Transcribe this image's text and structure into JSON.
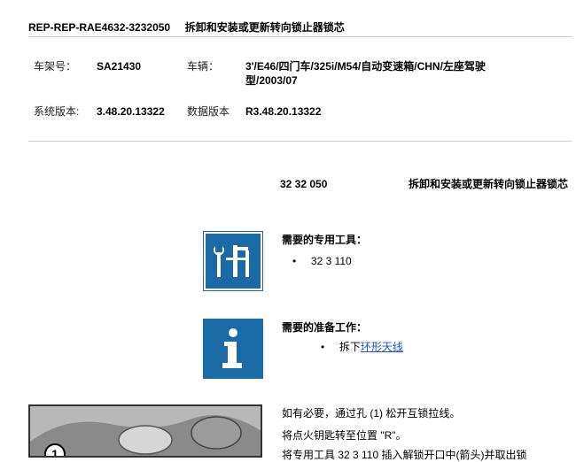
{
  "header": {
    "doc_id": "REP-REP-RAE4632-3232050",
    "doc_title": "拆卸和安装或更新转向锁止器锁芯"
  },
  "info": {
    "chassis_label": "车架号：",
    "chassis_value": "SA21430",
    "vehicle_label": "车辆：",
    "vehicle_value": "3'/E46/四门车/325i/M54/自动变速箱/CHN/左座驾驶型/2003/07",
    "sys_version_label": "系统版本:",
    "sys_version_value": "3.48.20.13322",
    "data_version_label": "数据版本",
    "data_version_value": "R3.48.20.13322"
  },
  "procedure": {
    "code": "32 32 050",
    "name": "拆卸和安装或更新转向锁止器锁芯"
  },
  "tools": {
    "icon": "tools-icon",
    "heading": "需要的专用工具：",
    "items": [
      "32 3 110"
    ]
  },
  "prep": {
    "icon": "info-icon",
    "heading": "需要的准备工作：",
    "item_prefix": "拆下",
    "item_link": "环形天线"
  },
  "steps": {
    "line1": "如有必要，通过孔 (1) 松开互锁拉线。",
    "line2": "将点火钥匙转至位置 \"R\"。",
    "line3": "将专用工具 32 3 110 插入解锁开口中(箭头)并取出锁"
  },
  "figure": {
    "callout": "1"
  }
}
